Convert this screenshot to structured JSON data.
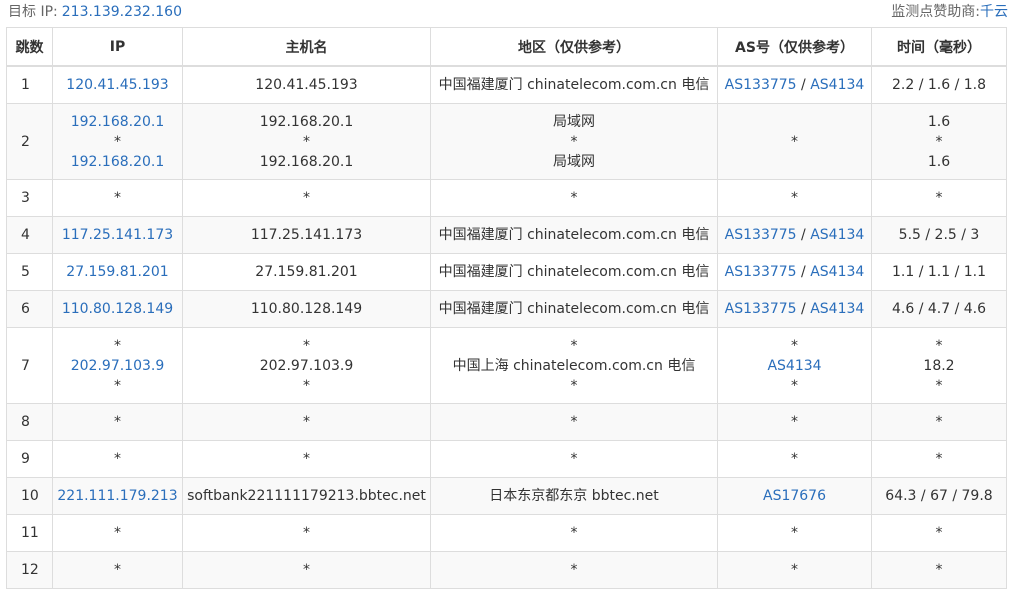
{
  "header": {
    "target_label": "目标 IP:",
    "target_ip": "213.139.232.160",
    "sponsor_label": "监测点赞助商:",
    "sponsor_name": "千云"
  },
  "table": {
    "headers": [
      "跳数",
      "IP",
      "主机名",
      "地区（仅供参考）",
      "AS号（仅供参考）",
      "时间（毫秒）"
    ],
    "rows": [
      {
        "hop": "1",
        "ip": [
          "120.41.45.193"
        ],
        "host": [
          "120.41.45.193"
        ],
        "region": [
          "中国福建厦门 chinatelecom.com.cn 电信"
        ],
        "as": [
          [
            "AS133775",
            "AS4134"
          ]
        ],
        "time": [
          "2.2 / 1.6 / 1.8"
        ]
      },
      {
        "hop": "2",
        "ip": [
          "192.168.20.1",
          "*",
          "192.168.20.1"
        ],
        "host": [
          "192.168.20.1",
          "*",
          "192.168.20.1"
        ],
        "region": [
          "局域网",
          "*",
          "局域网"
        ],
        "as": [
          [
            "*"
          ]
        ],
        "time": [
          "1.6",
          "*",
          "1.6"
        ]
      },
      {
        "hop": "3",
        "ip": [
          "*"
        ],
        "host": [
          "*"
        ],
        "region": [
          "*"
        ],
        "as": [
          [
            "*"
          ]
        ],
        "time": [
          "*"
        ]
      },
      {
        "hop": "4",
        "ip": [
          "117.25.141.173"
        ],
        "host": [
          "117.25.141.173"
        ],
        "region": [
          "中国福建厦门 chinatelecom.com.cn 电信"
        ],
        "as": [
          [
            "AS133775",
            "AS4134"
          ]
        ],
        "time": [
          "5.5 / 2.5 / 3"
        ]
      },
      {
        "hop": "5",
        "ip": [
          "27.159.81.201"
        ],
        "host": [
          "27.159.81.201"
        ],
        "region": [
          "中国福建厦门 chinatelecom.com.cn 电信"
        ],
        "as": [
          [
            "AS133775",
            "AS4134"
          ]
        ],
        "time": [
          "1.1 / 1.1 / 1.1"
        ]
      },
      {
        "hop": "6",
        "ip": [
          "110.80.128.149"
        ],
        "host": [
          "110.80.128.149"
        ],
        "region": [
          "中国福建厦门 chinatelecom.com.cn 电信"
        ],
        "as": [
          [
            "AS133775",
            "AS4134"
          ]
        ],
        "time": [
          "4.6 / 4.7 / 4.6"
        ]
      },
      {
        "hop": "7",
        "ip": [
          "*",
          "202.97.103.9",
          "*"
        ],
        "host": [
          "*",
          "202.97.103.9",
          "*"
        ],
        "region": [
          "*",
          "中国上海 chinatelecom.com.cn 电信",
          "*"
        ],
        "as": [
          [
            "*"
          ],
          [
            "AS4134"
          ],
          [
            "*"
          ]
        ],
        "time": [
          "*",
          "18.2",
          "*"
        ]
      },
      {
        "hop": "8",
        "ip": [
          "*"
        ],
        "host": [
          "*"
        ],
        "region": [
          "*"
        ],
        "as": [
          [
            "*"
          ]
        ],
        "time": [
          "*"
        ]
      },
      {
        "hop": "9",
        "ip": [
          "*"
        ],
        "host": [
          "*"
        ],
        "region": [
          "*"
        ],
        "as": [
          [
            "*"
          ]
        ],
        "time": [
          "*"
        ]
      },
      {
        "hop": "10",
        "ip": [
          "221.111.179.213"
        ],
        "host": [
          "softbank221111179213.bbtec.net"
        ],
        "region": [
          "日本东京都东京 bbtec.net"
        ],
        "as": [
          [
            "AS17676"
          ]
        ],
        "time": [
          "64.3 / 67 / 79.8"
        ]
      },
      {
        "hop": "11",
        "ip": [
          "*"
        ],
        "host": [
          "*"
        ],
        "region": [
          "*"
        ],
        "as": [
          [
            "*"
          ]
        ],
        "time": [
          "*"
        ]
      },
      {
        "hop": "12",
        "ip": [
          "*"
        ],
        "host": [
          "*"
        ],
        "region": [
          "*"
        ],
        "as": [
          [
            "*"
          ]
        ],
        "time": [
          "*"
        ]
      }
    ]
  }
}
